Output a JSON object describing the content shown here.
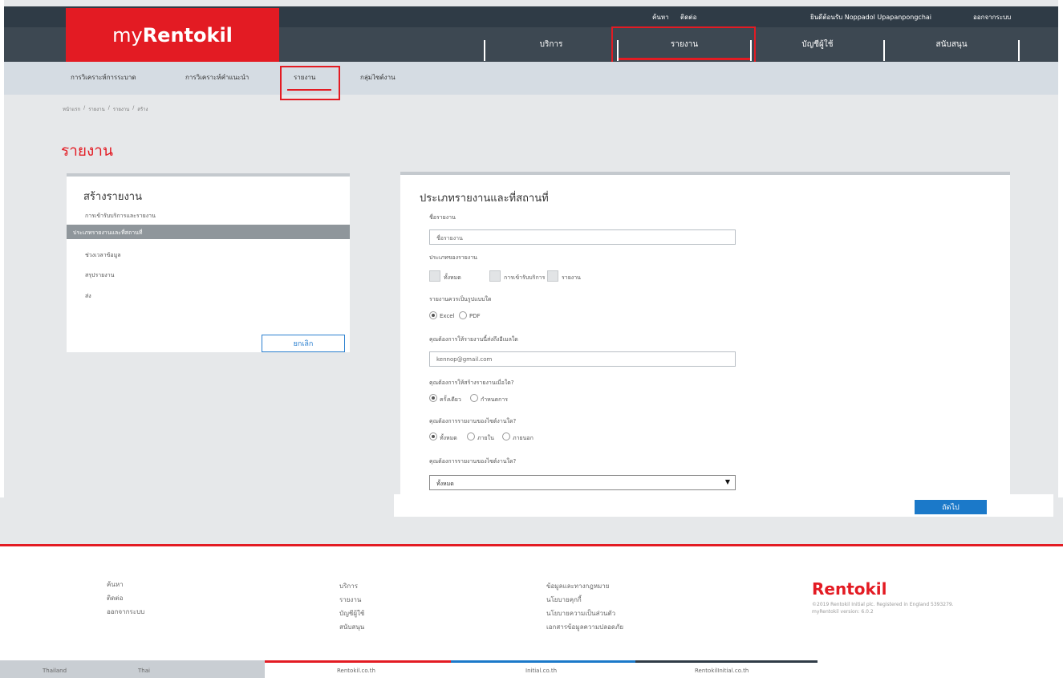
{
  "topbar": {
    "search": "ค้นหา",
    "contact": "ติดต่อ",
    "user": "ยินดีต้อนรับ Noppadol Upapanpongchai",
    "logout": "ออกจากระบบ"
  },
  "logo": {
    "my": "my",
    "brand": "Rentokil"
  },
  "mainnav": [
    {
      "label": "บริการ"
    },
    {
      "label": "รายงาน"
    },
    {
      "label": "บัญชีผู้ใช้"
    },
    {
      "label": "สนับสนุน"
    }
  ],
  "subnav": [
    {
      "label": "การวิเคราะห์การระบาด"
    },
    {
      "label": "การวิเคราะห์คำแนะนำ"
    },
    {
      "label": "รายงาน"
    },
    {
      "label": "กลุ่มไซต์งาน"
    }
  ],
  "breadcrumb": [
    "หน้าแรก",
    "/",
    "รายงาน",
    "/",
    "รายงาน",
    "/",
    "สร้าง"
  ],
  "page_title": "รายงาน",
  "left_panel": {
    "title": "สร้างรายงาน",
    "items": [
      "การเข้ารับบริการและรายงาน",
      "ประเภทรายงานและที่สถานที่",
      "ช่วงเวลาข้อมูล",
      "สรุปรายงาน",
      "ส่ง"
    ],
    "cancel_label": "ยกเลิก"
  },
  "form": {
    "title": "ประเภทรายงานและที่สถานที่",
    "report_name_label": "ชื่อรายงาน",
    "report_name_placeholder": "ชื่อรายงาน",
    "report_type_label": "ประเภทของรายงาน",
    "report_types": [
      "ทั้งหมด",
      "การเข้ารับบริการ",
      "รายงาน"
    ],
    "format_label": "รายงานควรเป็นรูปแบบใด",
    "formats": [
      "Excel",
      "PDF"
    ],
    "email_label": "คุณต้องการให้รายงานนี้ส่งถึงอีเมลใด",
    "email_value": "kennop@gmail.com",
    "frequency_label": "คุณต้องการให้สร้างรายงานเมื่อใด?",
    "frequencies": [
      "ครั้งเดียว",
      "กำหนดการ"
    ],
    "scope_label": "คุณต้องการรายงานของไซต์งานใด?",
    "scopes": [
      "ทั้งหมด",
      "ภายใน",
      "ภายนอก"
    ],
    "site_label": "คุณต้องการรายงานของไซต์งานใด?",
    "site_value": "ทั้งหมด"
  },
  "next_label": "ถัดไป",
  "footer": {
    "col1": [
      "ค้นหา",
      "ติดต่อ",
      "ออกจากระบบ"
    ],
    "col2": [
      "บริการ",
      "รายงาน",
      "บัญชีผู้ใช้",
      "สนับสนุน"
    ],
    "col3": [
      "ข้อมูลและทางกฎหมาย",
      "นโยบายคุกกี้",
      "นโยบายความเป็นส่วนตัว",
      "เอกสารข้อมูลความปลอดภัย"
    ],
    "logo": "Rentokil",
    "copyright": "©2019 Rentokil Initial plc. Registered in England 5393279.",
    "version": "myRentokil version: 6.0.2"
  },
  "bottom": {
    "country": "Thailand",
    "language": "Thai",
    "links": [
      "Rentokil.co.th",
      "Initial.co.th",
      "RentokilInitial.co.th"
    ]
  }
}
